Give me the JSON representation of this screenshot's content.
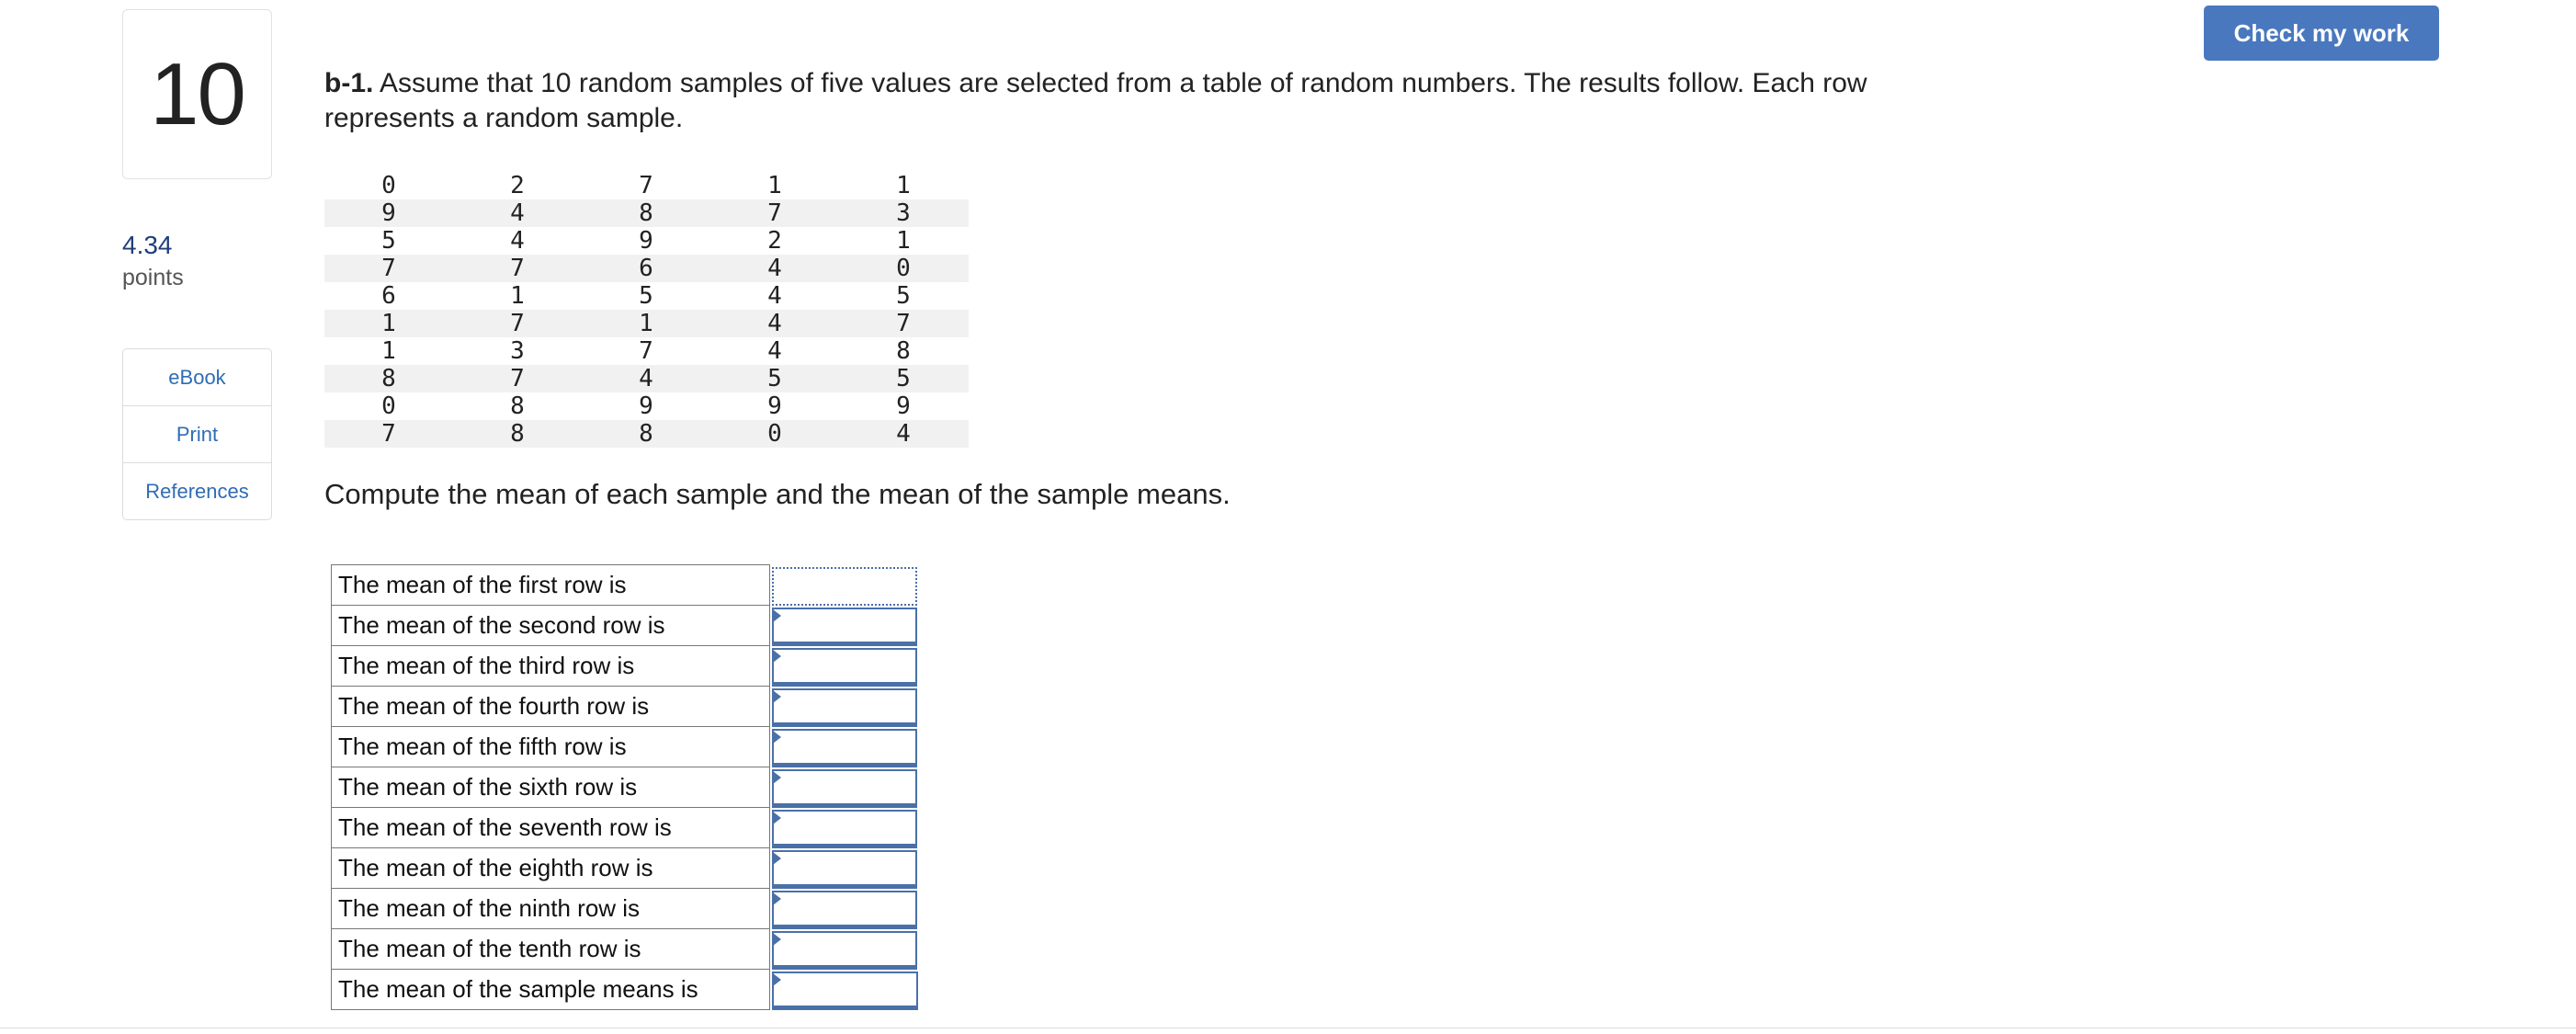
{
  "question": {
    "number": "10",
    "points_value": "4.34",
    "points_label": "points",
    "part_label": "b-1.",
    "prompt": "Assume that 10 random samples of five values are selected from a table of random numbers. The results follow. Each row represents a random sample.",
    "instruction": "Compute the mean of each sample and the mean of the sample means."
  },
  "sidebar": {
    "items": [
      {
        "label": "eBook"
      },
      {
        "label": "Print"
      },
      {
        "label": "References"
      }
    ]
  },
  "toolbar": {
    "check_label": "Check my work"
  },
  "random_table": {
    "rows": [
      [
        "0",
        "2",
        "7",
        "1",
        "1"
      ],
      [
        "9",
        "4",
        "8",
        "7",
        "3"
      ],
      [
        "5",
        "4",
        "9",
        "2",
        "1"
      ],
      [
        "7",
        "7",
        "6",
        "4",
        "0"
      ],
      [
        "6",
        "1",
        "5",
        "4",
        "5"
      ],
      [
        "1",
        "7",
        "1",
        "4",
        "7"
      ],
      [
        "1",
        "3",
        "7",
        "4",
        "8"
      ],
      [
        "8",
        "7",
        "4",
        "5",
        "5"
      ],
      [
        "0",
        "8",
        "9",
        "9",
        "9"
      ],
      [
        "7",
        "8",
        "8",
        "0",
        "4"
      ]
    ]
  },
  "answers": {
    "rows": [
      {
        "label": "The mean of the first row is",
        "value": ""
      },
      {
        "label": "The mean of the second row is",
        "value": ""
      },
      {
        "label": "The mean of the third row is",
        "value": ""
      },
      {
        "label": "The mean of the fourth row is",
        "value": ""
      },
      {
        "label": "The mean of the fifth row is",
        "value": ""
      },
      {
        "label": "The mean of the sixth row is",
        "value": ""
      },
      {
        "label": "The mean of the seventh row is",
        "value": ""
      },
      {
        "label": "The mean of the eighth row is",
        "value": ""
      },
      {
        "label": "The mean of the ninth row is",
        "value": ""
      },
      {
        "label": "The mean of the tenth row is",
        "value": ""
      },
      {
        "label": "The mean of the sample means is",
        "value": ""
      }
    ]
  }
}
